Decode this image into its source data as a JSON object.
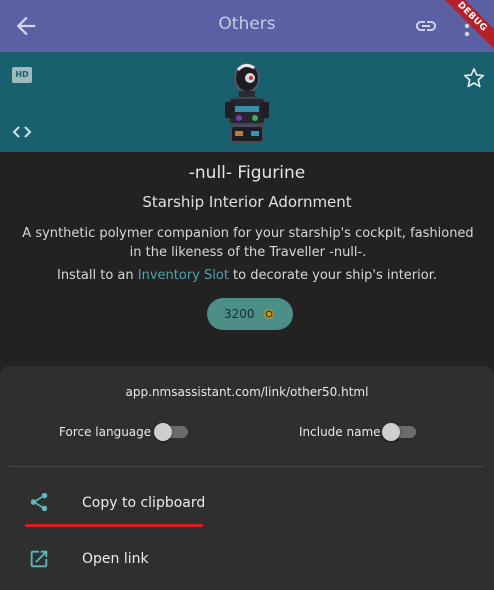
{
  "appbar": {
    "title": "Others",
    "debug_label": "DEBUG"
  },
  "hero": {
    "hd_badge": "HD"
  },
  "item": {
    "name": "-null- Figurine",
    "group": "Starship Interior Adornment",
    "description": "A synthetic polymer companion for your starship's cockpit, fashioned in the likeness of the Traveller -null-.",
    "install_prefix": "Install to an ",
    "install_link": "Inventory Slot",
    "install_suffix": " to decorate your ship's interior.",
    "price": "3200"
  },
  "share_sheet": {
    "url": "app.nmsassistant.com/link/other50.html",
    "force_language_label": "Force language",
    "force_language_on": false,
    "include_name_label": "Include name",
    "include_name_on": false,
    "copy_label": "Copy to clipboard",
    "open_label": "Open link"
  },
  "colors": {
    "appbar": "#5b5fa3",
    "hero": "#19606f",
    "accent": "#4fa3b3",
    "price_chip": "#4c8e88",
    "highlight_underline": "#d91c1c"
  }
}
